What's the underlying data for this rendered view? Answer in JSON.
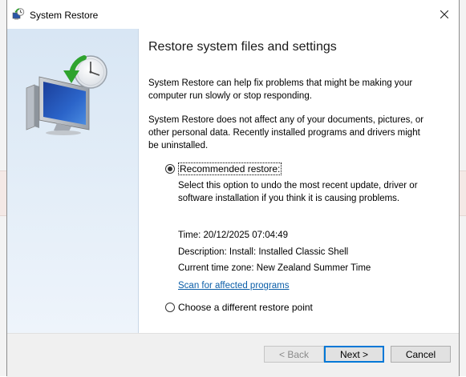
{
  "window": {
    "title": "System Restore",
    "close_label": "×"
  },
  "content": {
    "heading": "Restore system files and settings",
    "paragraph1": "System Restore can help fix problems that might be making your computer run slowly or stop responding.",
    "paragraph2": "System Restore does not affect any of your documents, pictures, or other personal data. Recently installed programs and drivers might be uninstalled.",
    "recommended": {
      "label": "Recommended restore:",
      "selected": true,
      "description": "Select this option to undo the most recent update, driver or software installation if you think it is causing problems.",
      "time": "Time: 20/12/2025 07:04:49",
      "desc_line": "Description: Install: Installed Classic Shell",
      "timezone": "Current time zone: New Zealand Summer Time",
      "scan_link": "Scan for affected programs"
    },
    "different": {
      "label": "Choose a different restore point",
      "selected": false
    }
  },
  "footer": {
    "back_label": "< Back",
    "next_label": "Next >",
    "cancel_label": "Cancel"
  },
  "icons": {
    "title_icon": "system-restore-icon",
    "hero": "system-restore-hero-icon",
    "close": "close-icon"
  },
  "colors": {
    "accent": "#0078d7",
    "link": "#0b5ea8",
    "left_pane": "#dfeaf6"
  }
}
